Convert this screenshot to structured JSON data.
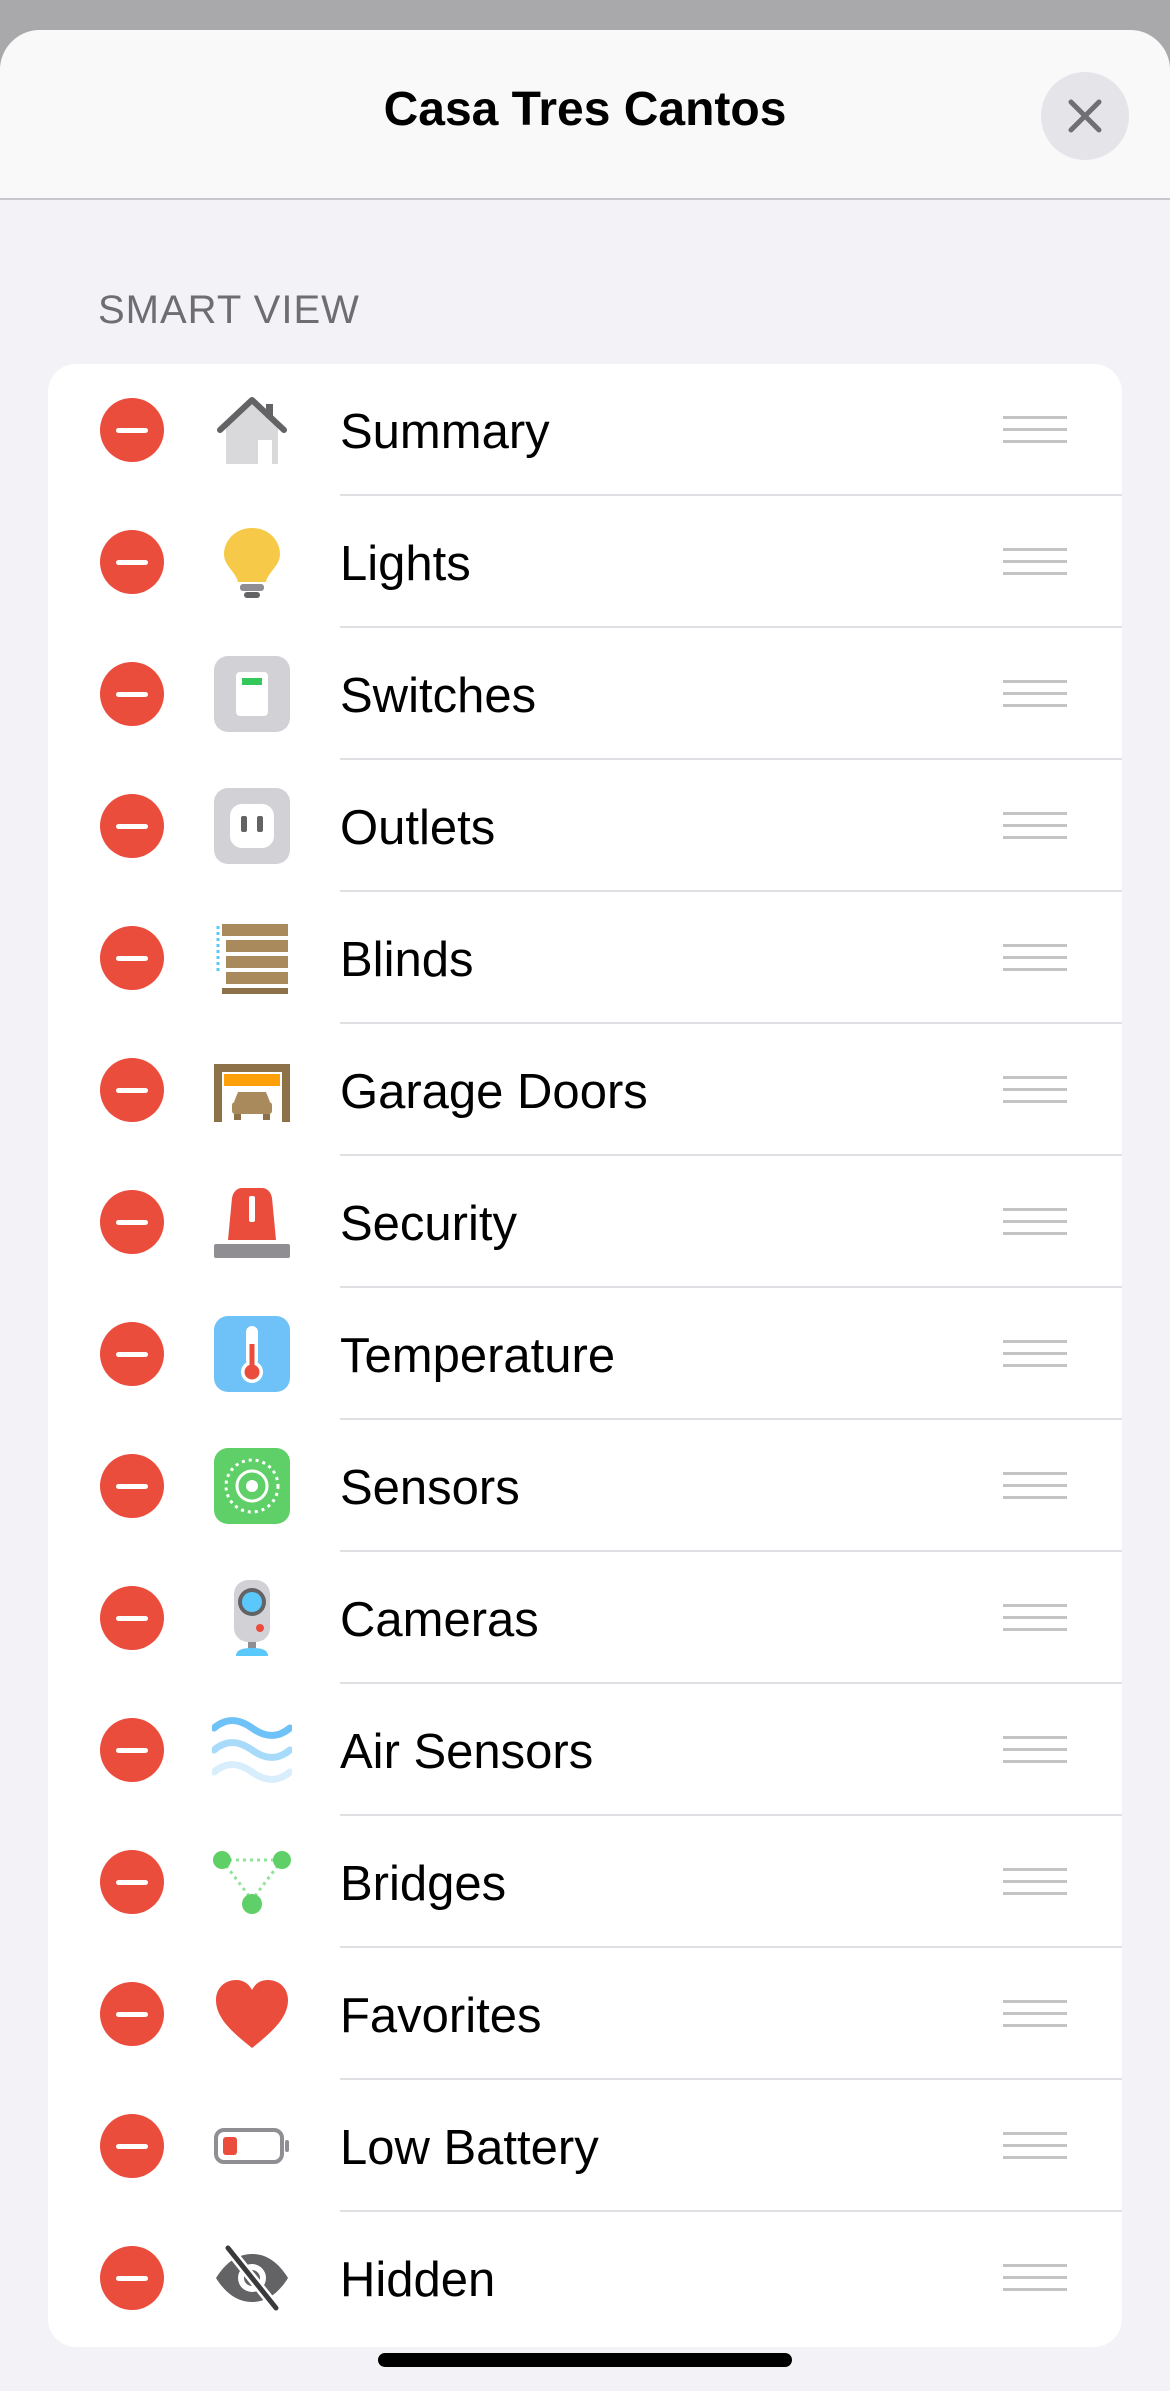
{
  "header": {
    "title": "Casa Tres Cantos",
    "close_icon": "xmark-icon"
  },
  "section": {
    "label": "SMART VIEW"
  },
  "items": [
    {
      "label": "Summary",
      "icon": "house-icon"
    },
    {
      "label": "Lights",
      "icon": "lightbulb-icon"
    },
    {
      "label": "Switches",
      "icon": "switch-icon"
    },
    {
      "label": "Outlets",
      "icon": "outlet-icon"
    },
    {
      "label": "Blinds",
      "icon": "blinds-icon"
    },
    {
      "label": "Garage Doors",
      "icon": "garage-icon"
    },
    {
      "label": "Security",
      "icon": "alarm-light-icon"
    },
    {
      "label": "Temperature",
      "icon": "thermometer-icon"
    },
    {
      "label": "Sensors",
      "icon": "sensor-icon"
    },
    {
      "label": "Cameras",
      "icon": "camera-icon"
    },
    {
      "label": "Air Sensors",
      "icon": "air-waves-icon"
    },
    {
      "label": "Bridges",
      "icon": "bridge-icon"
    },
    {
      "label": "Favorites",
      "icon": "heart-icon"
    },
    {
      "label": "Low Battery",
      "icon": "battery-low-icon"
    },
    {
      "label": "Hidden",
      "icon": "eye-slash-icon"
    }
  ],
  "colors": {
    "remove": "#eb4d3d",
    "background": "#f2f2f7",
    "card": "#ffffff"
  }
}
